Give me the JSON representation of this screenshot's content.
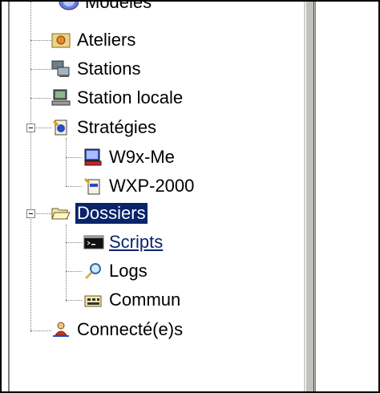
{
  "tree": {
    "items": [
      {
        "label": "Modèles",
        "icon": "globe-icon"
      },
      {
        "label": "Ateliers",
        "icon": "workshop-icon"
      },
      {
        "label": "Stations",
        "icon": "computers-icon"
      },
      {
        "label": "Station locale",
        "icon": "local-computer-icon"
      },
      {
        "label": "Stratégies",
        "icon": "policy-icon"
      },
      {
        "label": "W9x-Me",
        "icon": "w9x-policy-icon"
      },
      {
        "label": "WXP-2000",
        "icon": "wxp-policy-icon"
      },
      {
        "label": "Dossiers",
        "icon": "open-folder-icon"
      },
      {
        "label": "Scripts",
        "icon": "console-icon"
      },
      {
        "label": "Logs",
        "icon": "magnifier-icon"
      },
      {
        "label": "Commun",
        "icon": "shared-folder-icon"
      },
      {
        "label": "Connecté(e)s",
        "icon": "connected-user-icon"
      }
    ]
  },
  "colors": {
    "selection": "#0a246a",
    "tree_lines": "#808080",
    "scrollbar": "#d4d0c8"
  }
}
